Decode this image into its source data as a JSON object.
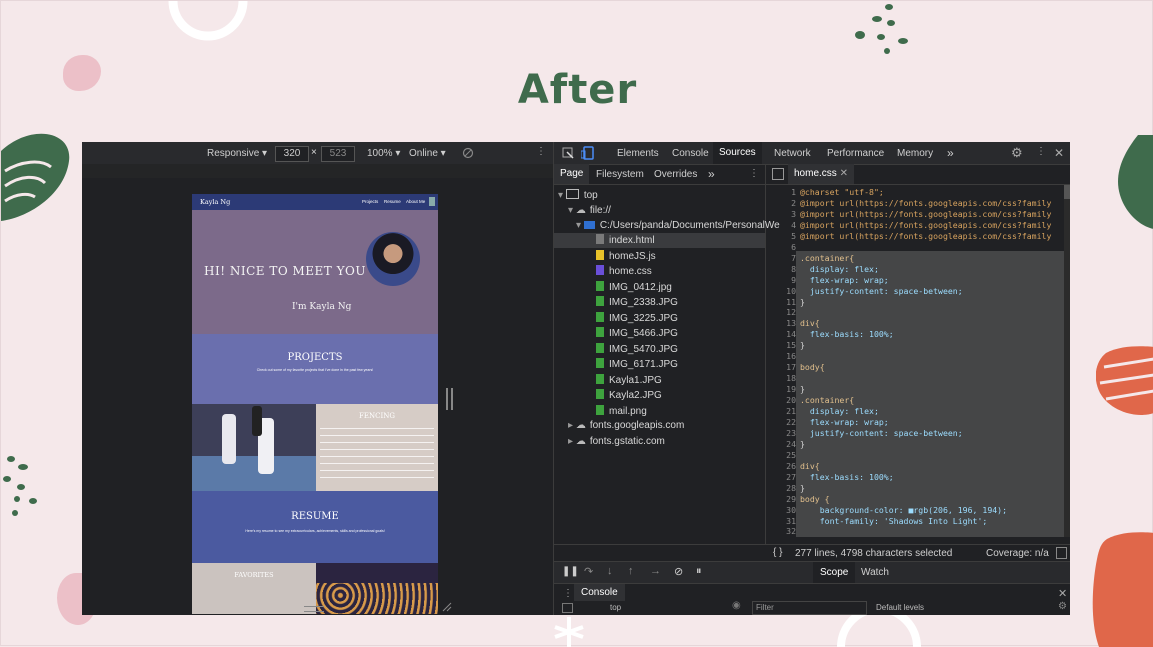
{
  "slide": {
    "title": "After"
  },
  "device_toolbar": {
    "mode": "Responsive",
    "width": "320",
    "times": "×",
    "height": "523",
    "zoom": "100%",
    "throttle": "Online"
  },
  "phone_page": {
    "brand": "Kayla Ng",
    "nav": [
      "Projects",
      "Resume",
      "About Me"
    ],
    "greeting": "HI! NICE TO MEET YOU",
    "name_line": "I'm Kayla Ng",
    "projects_heading": "PROJECTS",
    "projects_text": "Check out some of my favorite projects that I've done in the past few years!",
    "fencing_heading": "FENCING",
    "resume_heading": "RESUME",
    "resume_text": "Here's my resume to see my extracurriculars, achievements, skills and professional goals!",
    "favorites_heading": "FAVORITES"
  },
  "devtools": {
    "tabs": [
      "Elements",
      "Console",
      "Sources",
      "Network",
      "Performance",
      "Memory"
    ],
    "active_tab": "Sources",
    "more": "»",
    "nav_tabs": [
      "Page",
      "Filesystem",
      "Overrides"
    ],
    "tree": {
      "top": "top",
      "file": "file://",
      "folder": "C:/Users/panda/Documents/PersonalWe",
      "files": [
        "index.html",
        "homeJS.js",
        "home.css",
        "IMG_0412.jpg",
        "IMG_2338.JPG",
        "IMG_3225.JPG",
        "IMG_5466.JPG",
        "IMG_5470.JPG",
        "IMG_6171.JPG",
        "Kayla1.JPG",
        "Kayla2.JPG",
        "mail.png"
      ],
      "file_colors": [
        "#7a7a7a",
        "#e8c22a",
        "#6a4fd8",
        "#3ea33e",
        "#3ea33e",
        "#3ea33e",
        "#3ea33e",
        "#3ea33e",
        "#3ea33e",
        "#3ea33e",
        "#3ea33e",
        "#3ea33e"
      ],
      "origins": [
        "fonts.googleapis.com",
        "fonts.gstatic.com"
      ]
    },
    "editor_tab": "home.css",
    "code_lines": [
      "@charset \"utf-8\";",
      "@import url(https://fonts.googleapis.com/css?family",
      "@import url(https://fonts.googleapis.com/css?family",
      "@import url(https://fonts.googleapis.com/css?family",
      "@import url(https://fonts.googleapis.com/css?family",
      "",
      ".container{",
      "  display: flex;",
      "  flex-wrap: wrap;",
      "  justify-content: space-between;",
      "}",
      "",
      "div{",
      "  flex-basis: 100%;",
      "}",
      "",
      "body{",
      "",
      "}",
      ".container{",
      "  display: flex;",
      "  flex-wrap: wrap;",
      "  justify-content: space-between;",
      "}",
      "",
      "div{",
      "  flex-basis: 100%;",
      "}",
      "body {",
      "    background-color: ■rgb(206, 196, 194);",
      "    font-family: 'Shadows Into Light';",
      ""
    ],
    "status_text": "277 lines, 4798 characters selected",
    "coverage": "Coverage: n/a",
    "scope_tabs": [
      "Scope",
      "Watch"
    ],
    "console_label": "Console",
    "console_context": "top",
    "console_filter": "Filter",
    "console_levels": "Default levels"
  },
  "colors": {
    "title": "#3f6b4c",
    "slide_bg": "#f5e8ea",
    "accent_green": "#3f6b4c",
    "accent_orange": "#e0674a",
    "accent_pink": "#ecc0c8"
  }
}
